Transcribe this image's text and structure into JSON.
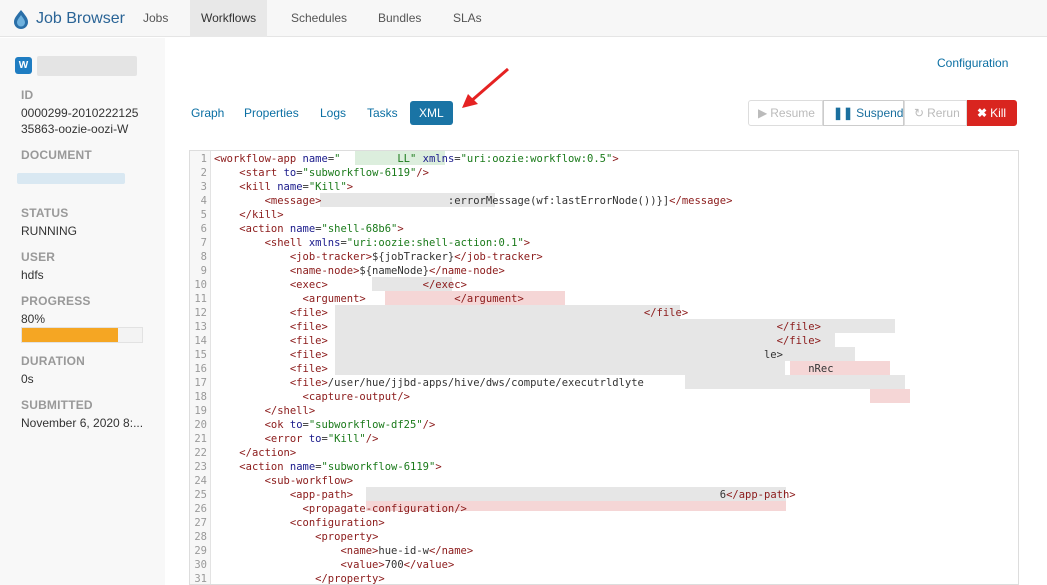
{
  "app": {
    "title": "Job Browser"
  },
  "nav": {
    "items": [
      {
        "label": "Jobs"
      },
      {
        "label": "Workflows"
      },
      {
        "label": "Schedules"
      },
      {
        "label": "Bundles"
      },
      {
        "label": "SLAs"
      }
    ],
    "active": "Workflows"
  },
  "sidebar": {
    "id_label": "ID",
    "id_line1": "0000299-2010222125",
    "id_line2": "35863-oozie-oozi-W",
    "document_label": "DOCUMENT",
    "status_label": "STATUS",
    "status_value": "RUNNING",
    "user_label": "USER",
    "user_value": "hdfs",
    "progress_label": "PROGRESS",
    "progress_value": "80%",
    "progress_fraction": 0.8,
    "duration_label": "DURATION",
    "duration_value": "0s",
    "submitted_label": "SUBMITTED",
    "submitted_value": "November 6, 2020 8:..."
  },
  "main": {
    "configuration_link": "Configuration",
    "tabs": [
      "Graph",
      "Properties",
      "Logs",
      "Tasks",
      "XML"
    ],
    "active_tab": "XML",
    "actions": {
      "resume": "Resume",
      "suspend": "Suspend",
      "rerun": "Rerun",
      "kill": "Kill"
    }
  },
  "xml": {
    "lines": [
      {
        "n": "1",
        "text": "<workflow-app name=\"         LL\" xmlns=\"uri:oozie:workflow:0.5\">"
      },
      {
        "n": "2",
        "text": "    <start to=\"subworkflow-6119\"/>"
      },
      {
        "n": "3",
        "text": "    <kill name=\"Kill\">"
      },
      {
        "n": "4",
        "text": "        <message>                    :errorMessage(wf:lastErrorNode())}]</message>"
      },
      {
        "n": "5",
        "text": "    </kill>"
      },
      {
        "n": "6",
        "text": "    <action name=\"shell-68b6\">"
      },
      {
        "n": "7",
        "text": "        <shell xmlns=\"uri:oozie:shell-action:0.1\">"
      },
      {
        "n": "8",
        "text": "            <job-tracker>${jobTracker}</job-tracker>"
      },
      {
        "n": "9",
        "text": "            <name-node>${nameNode}</name-node>"
      },
      {
        "n": "10",
        "text": "            <exec>               </exec>"
      },
      {
        "n": "11",
        "text": "              <argument>              </argument>"
      },
      {
        "n": "12",
        "text": "            <file>                                                  </file>"
      },
      {
        "n": "13",
        "text": "            <file>                                                                       </file>"
      },
      {
        "n": "14",
        "text": "            <file>                                                                       </file>"
      },
      {
        "n": "15",
        "text": "            <file>                                                                     le>"
      },
      {
        "n": "16",
        "text": "            <file>                                                                            nRec"
      },
      {
        "n": "17",
        "text": "            <file>/user/hue/jjbd-apps/hive/dws/compute/executrldlyte"
      },
      {
        "n": "18",
        "text": "              <capture-output/>"
      },
      {
        "n": "19",
        "text": "        </shell>"
      },
      {
        "n": "20",
        "text": "        <ok to=\"subworkflow-df25\"/>"
      },
      {
        "n": "21",
        "text": "        <error to=\"Kill\"/>"
      },
      {
        "n": "22",
        "text": "    </action>"
      },
      {
        "n": "23",
        "text": "    <action name=\"subworkflow-6119\">"
      },
      {
        "n": "24",
        "text": "        <sub-workflow>"
      },
      {
        "n": "25",
        "text": "            <app-path>                                                          6</app-path>"
      },
      {
        "n": "26",
        "text": "              <propagate-configuration/>"
      },
      {
        "n": "27",
        "text": "            <configuration>"
      },
      {
        "n": "28",
        "text": "                <property>"
      },
      {
        "n": "29",
        "text": "                    <name>hue-id-w</name>"
      },
      {
        "n": "30",
        "text": "                    <value>700</value>"
      },
      {
        "n": "31",
        "text": "                </property>"
      }
    ]
  },
  "colors": {
    "brand": "#2a6496",
    "link": "#0b6fa3",
    "active_tab_bg": "#1a74a5",
    "kill_bg": "#d9251f",
    "progress_fill": "#f5a623",
    "annotation_arrow": "#e52222"
  },
  "icons": {
    "brand": "hue-logo-icon",
    "workflow": "workflow-w-icon",
    "resume": "play-icon",
    "suspend": "pause-icon",
    "rerun": "refresh-icon",
    "kill": "close-icon"
  }
}
